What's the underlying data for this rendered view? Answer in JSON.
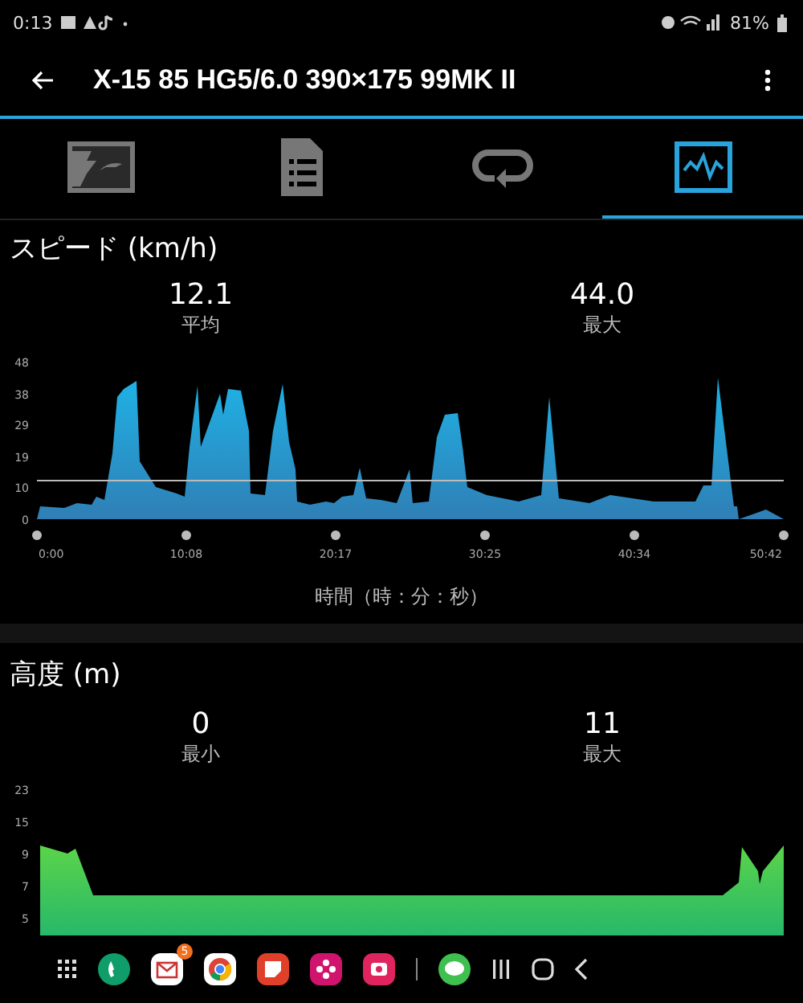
{
  "status_bar": {
    "time": "0:13",
    "battery": "81%"
  },
  "app_bar": {
    "title": "X-15 85 HG5/6.0 390×175 99MK II"
  },
  "tabs": [
    {
      "kind": "map",
      "selected": false
    },
    {
      "kind": "list",
      "selected": false
    },
    {
      "kind": "laps",
      "selected": false
    },
    {
      "kind": "graph",
      "selected": true
    }
  ],
  "sections": [
    {
      "kind": "speed",
      "title": "スピード (km/h)",
      "stats": [
        {
          "value": "12.1",
          "label": "平均"
        },
        {
          "value": "44.0",
          "label": "最大"
        }
      ],
      "yticks": [
        "48",
        "38",
        "29",
        "19",
        "10",
        "0"
      ],
      "xticks": [
        "0:00",
        "10:08",
        "20:17",
        "30:25",
        "40:34",
        "50:42"
      ],
      "xlabel": "時間（時：分：秒）"
    },
    {
      "kind": "altitude",
      "title": "高度 (m)",
      "stats": [
        {
          "value": "0",
          "label": "最小"
        },
        {
          "value": "11",
          "label": "最大"
        }
      ],
      "yticks": [
        "23",
        "15",
        "9",
        "7",
        "5"
      ]
    }
  ],
  "nav_bar": {
    "mail_badge": "5"
  }
}
